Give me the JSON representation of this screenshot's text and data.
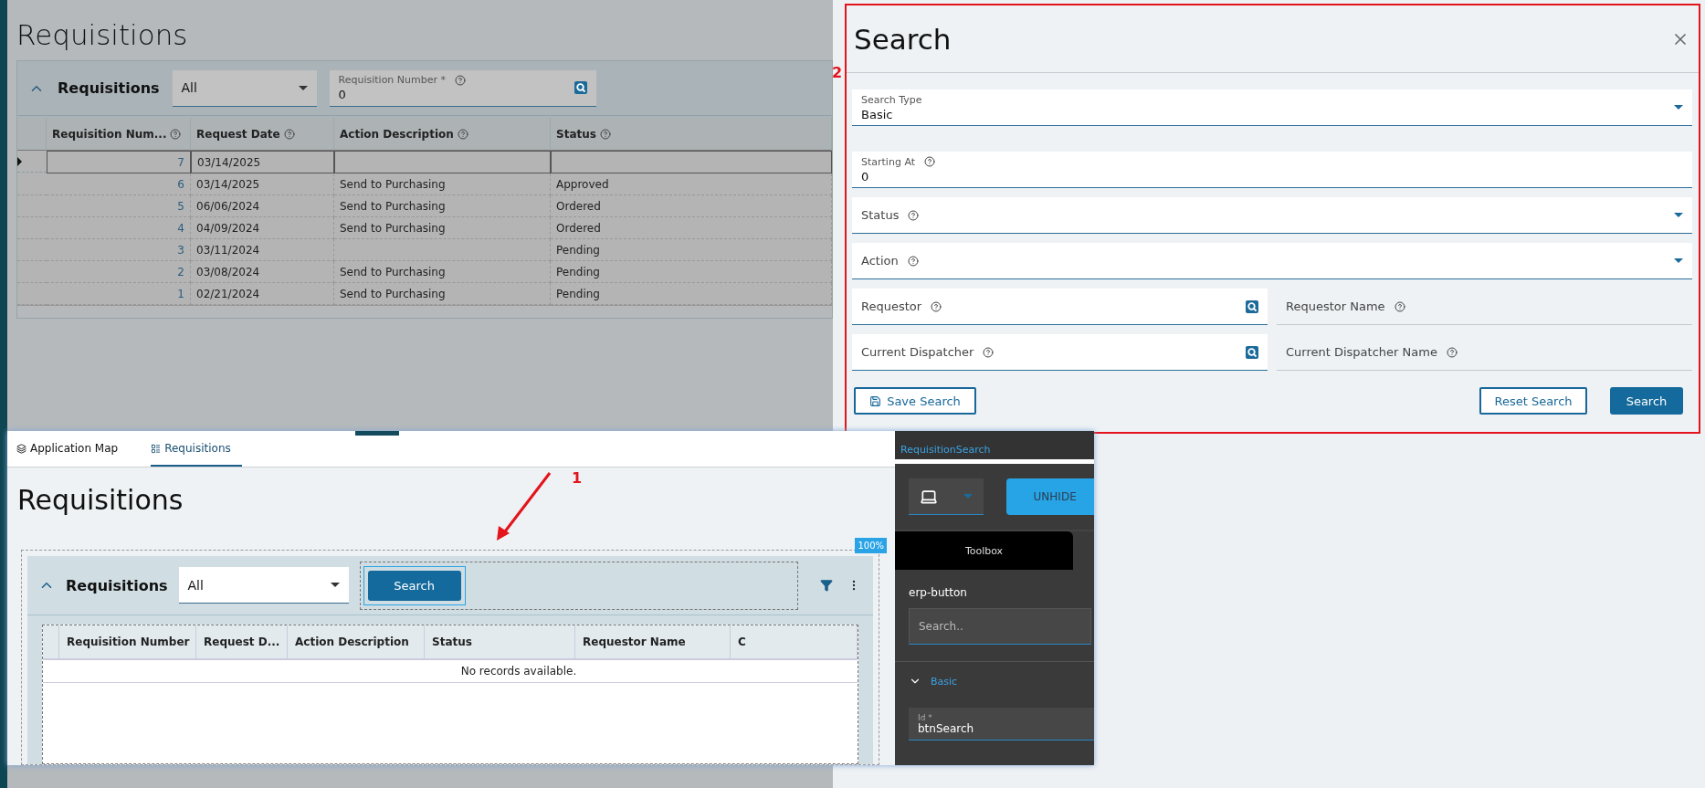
{
  "background_page": {
    "title": "Requisitions",
    "panel": {
      "title": "Requisitions",
      "filter": "All",
      "lookup": {
        "label": "Requisition Number *",
        "value": "0"
      },
      "columns": [
        "Requisition Num...",
        "Request Date",
        "Action Description",
        "Status"
      ],
      "rows": [
        {
          "number": "7",
          "date": "03/14/2025",
          "selected": true
        },
        {
          "number": "6",
          "date": "03/14/2025",
          "action": "Send to Purchasing",
          "status": "Approved",
          "selected": false
        },
        {
          "number": "5",
          "date": "06/06/2024",
          "action": "Send to Purchasing",
          "status": "Ordered",
          "selected": false
        },
        {
          "number": "4",
          "date": "04/09/2024",
          "action": "Send to Purchasing",
          "status": "Ordered",
          "selected": false
        },
        {
          "number": "3",
          "date": "03/11/2024",
          "status": "Pending",
          "selected": false
        },
        {
          "number": "2",
          "date": "03/08/2024",
          "action": "Send to Purchasing",
          "status": "Pending",
          "selected": false
        },
        {
          "number": "1",
          "date": "02/21/2024",
          "action": "Send to Purchasing",
          "status": "Pending",
          "selected": false
        }
      ]
    }
  },
  "search_panel": {
    "marker": "2",
    "title": "Search",
    "field_rows": [
      [
        {
          "kind": "select",
          "label": "Search Type",
          "value": "Basic",
          "help": false
        }
      ],
      [
        {
          "kind": "text",
          "label": "Starting At",
          "value": "0",
          "help": true
        }
      ],
      [
        {
          "kind": "select",
          "label": "Status",
          "help": true
        }
      ],
      [
        {
          "kind": "select",
          "label": "Action",
          "help": true
        }
      ],
      [
        {
          "kind": "lookup",
          "label": "Requestor",
          "help": true
        },
        {
          "kind": "readonly",
          "label": "Requestor Name",
          "help": true
        }
      ],
      [
        {
          "kind": "lookup",
          "label": "Current Dispatcher",
          "help": true
        },
        {
          "kind": "readonly",
          "label": "Current Dispatcher Name",
          "help": true
        }
      ]
    ],
    "save_button": "Save Search",
    "reset_button": "Reset Search",
    "search_button": "Search"
  },
  "embedded_screenshot": {
    "marker": "1",
    "tabs": [
      {
        "label": "Application Map",
        "selected": false
      },
      {
        "label": "Requisitions",
        "selected": true
      }
    ],
    "title": "Requisitions",
    "zoom_badge": "100%",
    "panel": {
      "title": "Requisitions",
      "filter": "All",
      "search_button": "Search",
      "columns": [
        "Requisition Number",
        "Request D...",
        "Action Description",
        "Status",
        "Requestor Name",
        "C"
      ],
      "empty_message": "No records available."
    },
    "designer": {
      "link": "RequisitionSearch",
      "unhide_button": "UNHIDE",
      "tab": "Toolbox",
      "component": "erp-button",
      "search": {
        "placeholder": "Search.."
      },
      "section": {
        "label": "Basic",
        "expanded": true
      },
      "id_field": {
        "label": "Id *",
        "value": "btnSearch"
      }
    }
  }
}
